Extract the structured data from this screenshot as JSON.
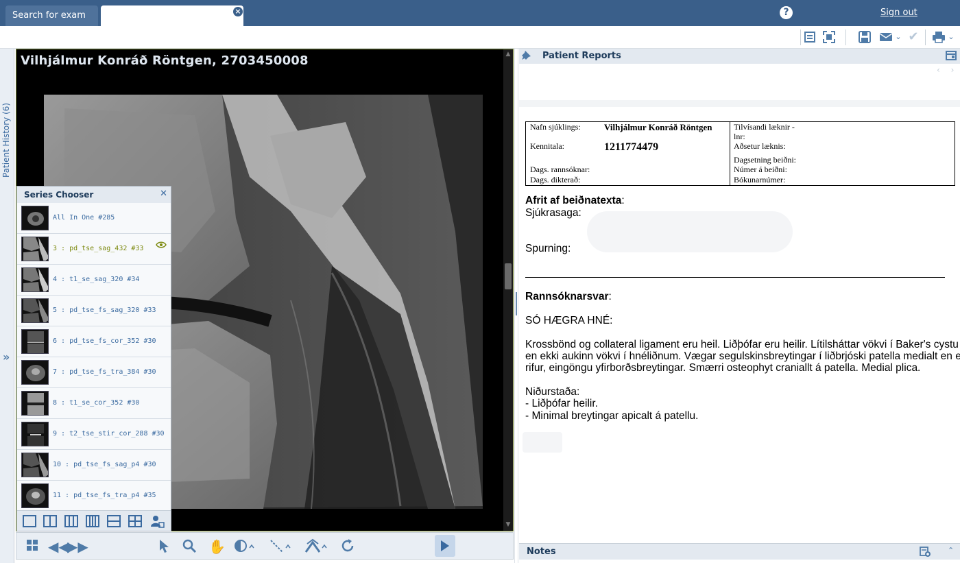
{
  "tabs": {
    "search_label": "Search for exam",
    "active_label": "",
    "close_icon": "close-circle-icon"
  },
  "header": {
    "help_label": "?",
    "signout_label": "Sign out"
  },
  "sidebar": {
    "history_label": "Patient History (6)",
    "expand_glyph": "»"
  },
  "viewer": {
    "patient_title": "Vilhjálmur Konráð Röntgen, 2703450008"
  },
  "series_chooser": {
    "title": "Series Chooser",
    "close_glyph": "✕",
    "items": [
      {
        "label": "All In One #285",
        "selected": false
      },
      {
        "label": "3 : pd_tse_sag_432 #33",
        "selected": true
      },
      {
        "label": "4 : t1_se_sag_320 #34",
        "selected": false
      },
      {
        "label": "5 : pd_tse_fs_sag_320 #33",
        "selected": false
      },
      {
        "label": "6 : pd_tse_fs_cor_352 #30",
        "selected": false
      },
      {
        "label": "7 : pd_tse_fs_tra_384 #30",
        "selected": false
      },
      {
        "label": "8 : t1_se_cor_352 #30",
        "selected": false
      },
      {
        "label": "9 : t2_tse_stir_cor_288 #30",
        "selected": false
      },
      {
        "label": "10 : pd_tse_fs_sag_p4 #30",
        "selected": false
      },
      {
        "label": "11 : pd_tse_fs_tra_p4 #35",
        "selected": false
      }
    ]
  },
  "reports": {
    "title": "Patient Reports",
    "nav_glyphs": "‹ ›",
    "table": {
      "name_label": "Nafn sjúklings:",
      "name_value": "Vilhjálmur Konráð Röntgen",
      "id_label": "Kennitala:",
      "id_value": "1211774479",
      "exam_date_label": "Dags. rannsóknar:",
      "dictated_label": "Dags. dikterað:",
      "referrer_label_1": "Tilvísandi læknir -",
      "referrer_label_2": "lnr:",
      "address_label": "Aðsetur læknis:",
      "request_date_label": "Dagsetning beiðni:",
      "request_no_label": "Númer á beiðni:",
      "booking_label": "Bókunarnúmer:"
    },
    "body": {
      "copy_heading": "Afrit af beiðnatexta",
      "colon": ":",
      "history_label": "Sjúkrasaga:",
      "question_label": "Spurning:",
      "findings_heading": "Rannsóknarsvar",
      "exam_title": "SÓ HÆGRA HNÉ:",
      "findings_line1": "Krossbönd og collateral ligament eru heil. Liðþófar eru heilir. Lítilsháttar vökvi í Baker's cystu",
      "findings_line2": "en ekki aukinn vökvi í hnéliðnum. Vægar segulskinsbreytingar í liðbrjóski patella medialt en engar",
      "findings_line3": "rifur, eingöngu yfirborðsbreytingar. Smærri osteophyt craniallt á patella. Medial plica.",
      "conclusion_label": "Niðurstaða:",
      "conclusion_1": "- Liðþófar heilir.",
      "conclusion_2": "- Minimal breytingar apicalt á patellu."
    }
  },
  "notes": {
    "title": "Notes"
  },
  "colors": {
    "header_bg": "#3a5f8a",
    "accent": "#4f7ba8",
    "selected_series": "#7d8a10",
    "viewer_border": "#7a8a3a"
  }
}
